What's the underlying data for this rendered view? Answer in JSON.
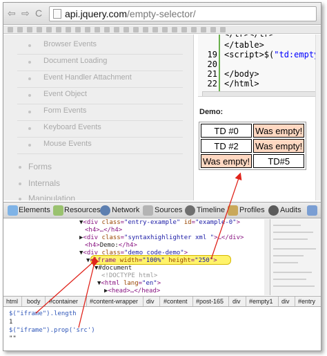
{
  "browser": {
    "back_glyph": "⇦",
    "forward_glyph": "⇨",
    "reload_glyph": "C",
    "url_domain": "api.jquery.com",
    "url_path": "/empty-selector/"
  },
  "sidebar": {
    "sub_items": [
      "Browser Events",
      "Document Loading",
      "Event Handler Attachment",
      "Event Object",
      "Form Events",
      "Keyboard Events",
      "Mouse Events"
    ],
    "top_items": [
      "Forms",
      "Internals",
      "Manipulation"
    ]
  },
  "code": {
    "lines": [
      {
        "num": "",
        "text": "  </table>"
      },
      {
        "num": "19",
        "text": "<script>$(\"td:empty\")"
      },
      {
        "num": "20",
        "text": ""
      },
      {
        "num": "21",
        "text": "</body>"
      },
      {
        "num": "22",
        "text": "</html>"
      }
    ]
  },
  "demo": {
    "label": "Demo:",
    "rows": [
      [
        "TD #0",
        "Was empty!"
      ],
      [
        "TD #2",
        "Was empty!"
      ],
      [
        "Was empty!",
        "TD#5"
      ]
    ]
  },
  "devtools": {
    "tabs": [
      "Elements",
      "Resources",
      "Network",
      "Sources",
      "Timeline",
      "Profiles",
      "Audits"
    ],
    "elements": {
      "lines": [
        {
          "indent": 110,
          "arrow": "▼",
          "tag": "<div ",
          "attr": "class",
          "val": "\"entry-example\"",
          "rest": " id=\"example-0\">"
        },
        {
          "indent": 118,
          "arrow": "",
          "tag": "<h4>…</h4>",
          "attr": "",
          "val": "",
          "rest": ""
        },
        {
          "indent": 110,
          "arrow": "▶",
          "tag": "<div ",
          "attr": "class",
          "val": "\"syntaxhighlighter xml \"",
          "rest": ">…</div>"
        },
        {
          "indent": 110,
          "arrow": "",
          "tag": "<h4>",
          "attr": "",
          "val": "Demo:",
          "rest": "</h4>"
        },
        {
          "indent": 110,
          "arrow": "▼",
          "tag": "<div ",
          "attr": "class",
          "val": "\"demo code-demo\"",
          "rest": ">"
        },
        {
          "indent": 120,
          "arrow": "▼",
          "tag": "<iframe ",
          "attr": "width",
          "val": "\"100%\"",
          "rest": " height=\"250\">"
        },
        {
          "indent": 132,
          "arrow": "▼",
          "tag": "#document",
          "attr": "",
          "val": "",
          "rest": ""
        },
        {
          "indent": 142,
          "arrow": "",
          "tag": "<!DOCTYPE html>",
          "attr": "",
          "val": "",
          "rest": ""
        },
        {
          "indent": 136,
          "arrow": "▼",
          "tag": "<html ",
          "attr": "lang",
          "val": "\"en\"",
          "rest": ">"
        },
        {
          "indent": 146,
          "arrow": "▶",
          "tag": "<head>…</head>",
          "attr": "",
          "val": "",
          "rest": ""
        }
      ]
    },
    "breadcrumbs": [
      "html",
      "body",
      "#container",
      "#content-wrapper",
      "div",
      "#content",
      "#post-165",
      "div",
      "#empty1",
      "div",
      "#entry"
    ],
    "console": {
      "lines": [
        {
          "type": "in",
          "text": "$(\"iframe\").length"
        },
        {
          "type": "out",
          "text": "1"
        },
        {
          "type": "in",
          "text": "$(\"iframe\").prop('src')"
        },
        {
          "type": "out",
          "text": "\"\""
        }
      ]
    }
  },
  "colors": {
    "highlight": "#fff36b",
    "empty_cell": "#ffd8c2",
    "arrow": "#e0241c"
  }
}
